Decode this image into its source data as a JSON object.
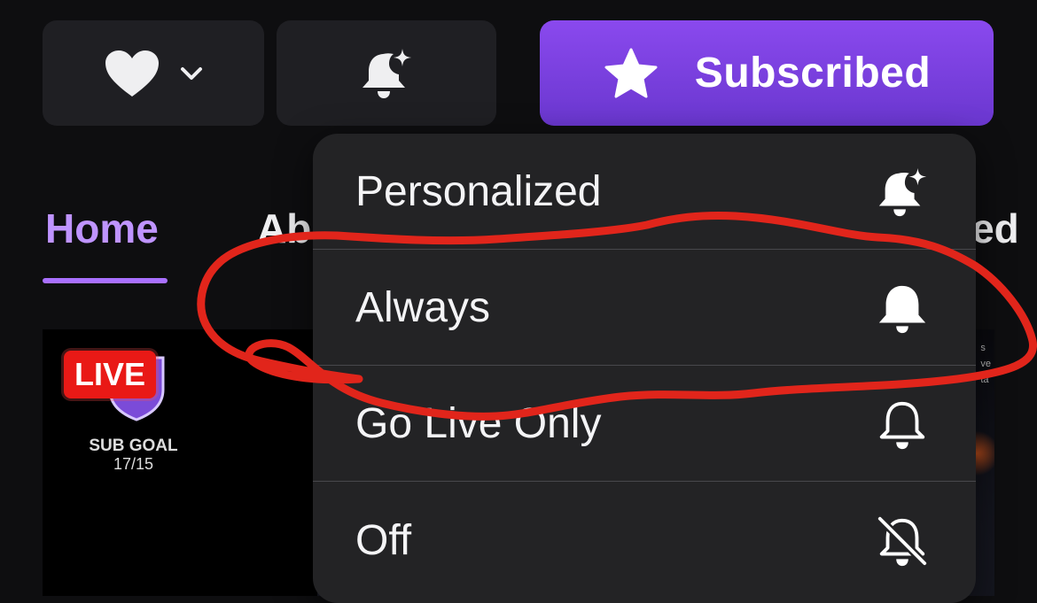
{
  "header": {
    "follow_icon": "heart-icon",
    "follow_dropdown_icon": "chevron-down-icon",
    "notify_icon": "bell-sparkle-icon",
    "subscribe_icon": "star-icon",
    "subscribe_label": "Subscribed",
    "subscribe_color": "#7a42e4"
  },
  "tabs": [
    {
      "label": "Home",
      "active": true
    },
    {
      "label": "Ab"
    },
    {
      "label": "hed"
    }
  ],
  "stream_preview": {
    "live_label": "LIVE",
    "sub_goal_title": "SUB GOAL",
    "sub_goal_value": "17/15",
    "side_text": [
      "s",
      "ve",
      "ta"
    ]
  },
  "notification_menu": {
    "items": [
      {
        "label": "Personalized",
        "icon": "bell-sparkle-icon"
      },
      {
        "label": "Always",
        "icon": "bell-filled-icon"
      },
      {
        "label": "Go Live Only",
        "icon": "bell-outline-icon"
      },
      {
        "label": "Off",
        "icon": "bell-off-icon"
      }
    ]
  },
  "annotation": {
    "color": "#e1251b",
    "shape": "freehand-loop",
    "highlights": "Always"
  },
  "accent_color": "#a970ff"
}
